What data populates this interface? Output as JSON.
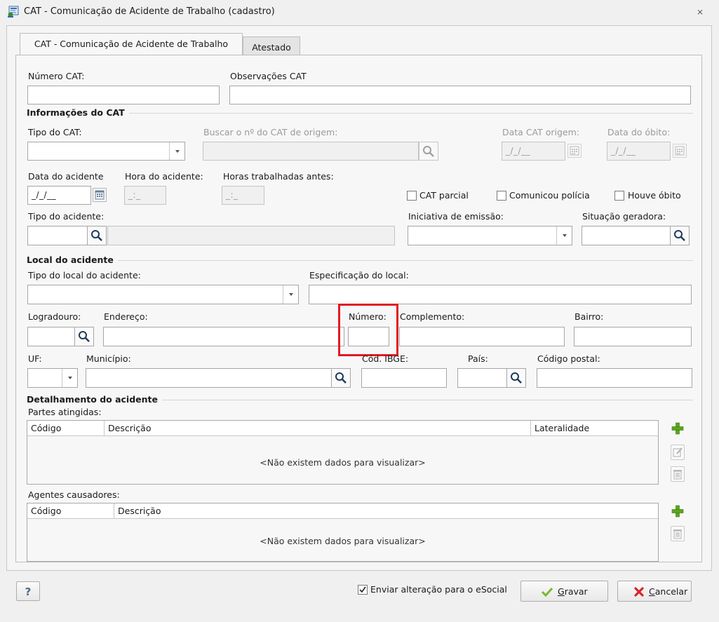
{
  "window": {
    "title": "CAT - Comunicação de Acidente de Trabalho (cadastro)"
  },
  "tabs": [
    {
      "label": "CAT - Comunicação de Acidente de Trabalho",
      "active": true
    },
    {
      "label": "Atestado",
      "active": false
    }
  ],
  "fields": {
    "numero_cat": {
      "label": "Número CAT:",
      "value": ""
    },
    "observacoes_cat": {
      "label": "Observações CAT",
      "value": ""
    }
  },
  "info_cat": {
    "section": "Informações do CAT",
    "tipo_cat": {
      "label": "Tipo do CAT:",
      "value": ""
    },
    "buscar_origem": {
      "label": "Buscar o nº do CAT de origem:",
      "value": ""
    },
    "data_cat_origem": {
      "label": "Data CAT origem:",
      "mask": "_/_/__"
    },
    "data_obito": {
      "label": "Data do óbito:",
      "mask": "_/_/__"
    },
    "data_acidente": {
      "label": "Data do acidente",
      "mask": "_/_/__"
    },
    "hora_acidente": {
      "label": "Hora do acidente:",
      "mask": "_:_"
    },
    "horas_trabalhadas": {
      "label": "Horas trabalhadas antes:",
      "mask": "_:_"
    },
    "cat_parcial": {
      "label": "CAT parcial",
      "checked": false
    },
    "comunicou_policia": {
      "label": "Comunicou polícia",
      "checked": false
    },
    "houve_obito": {
      "label": "Houve óbito",
      "checked": false
    },
    "tipo_acidente": {
      "label": "Tipo do acidente:",
      "code": "",
      "desc": ""
    },
    "iniciativa": {
      "label": "Iniciativa de emissão:",
      "value": ""
    },
    "situacao": {
      "label": "Situação geradora:",
      "value": ""
    }
  },
  "local": {
    "section": "Local do acidente",
    "tipo_local": {
      "label": "Tipo do local do acidente:",
      "value": ""
    },
    "especificacao": {
      "label": "Especificação do local:",
      "value": ""
    },
    "logradouro": {
      "label": "Logradouro:",
      "value": ""
    },
    "endereco": {
      "label": "Endereço:",
      "value": ""
    },
    "numero": {
      "label": "Número:",
      "value": ""
    },
    "complemento": {
      "label": "Complemento:",
      "value": ""
    },
    "bairro": {
      "label": "Bairro:",
      "value": ""
    },
    "uf": {
      "label": "UF:",
      "value": ""
    },
    "municipio": {
      "label": "Município:",
      "value": ""
    },
    "cod_ibge": {
      "label": "Cód. IBGE:",
      "value": ""
    },
    "pais": {
      "label": "País:",
      "value": ""
    },
    "cod_postal": {
      "label": "Código postal:",
      "value": ""
    }
  },
  "detalhamento": {
    "section": "Detalhamento do acidente",
    "partes": {
      "label": "Partes atingidas:",
      "columns": [
        "Código",
        "Descrição",
        "Lateralidade"
      ],
      "rows": [],
      "empty": "<Não existem dados para visualizar>"
    },
    "agentes": {
      "label": "Agentes causadores:",
      "columns": [
        "Código",
        "Descrição"
      ],
      "rows": [],
      "empty": "<Não existem dados para visualizar>"
    }
  },
  "footer": {
    "help": "?",
    "esocial": {
      "label": "Enviar alteração para o eSocial",
      "checked": true
    },
    "gravar_first": "G",
    "gravar_rest": "ravar",
    "cancelar_first": "C",
    "cancelar_rest": "ancelar"
  },
  "colors": {
    "highlight": "#e01b24",
    "add_green": "#5aa51e",
    "cancel_red": "#d8262b"
  }
}
